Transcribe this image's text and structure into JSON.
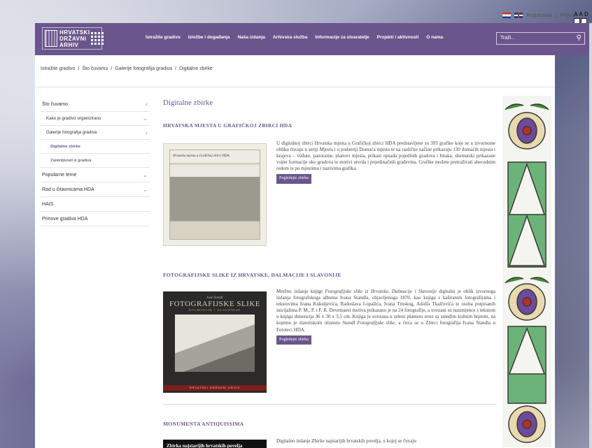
{
  "topbar": {
    "register": "Registracija",
    "separator": "|",
    "login": "Prijava"
  },
  "a11y": {
    "line1": "A A D"
  },
  "header": {
    "logo_lines": [
      "HRVATSKI",
      "DRŽAVNI",
      "ARHIV"
    ],
    "nav": [
      "Istražite gradivo",
      "Izložbe i događanja",
      "Naša izdanja",
      "Arhivska služba",
      "Informacije za stvaratelje",
      "Projekti i aktivnosti",
      "O nama"
    ],
    "search_placeholder": "Traži...",
    "search_icon": "search-icon",
    "brand_color": "#6a568d"
  },
  "breadcrumb": [
    "Istražite gradivo",
    "Što čuvamo",
    "Galerije fotografija gradiva",
    "Digitalne zbirke"
  ],
  "breadcrumb_sep": "/",
  "sidebar": {
    "items": [
      {
        "label": "Što čuvamo",
        "level": 1,
        "chevron": "‹"
      },
      {
        "label": "Kako je gradivo organizirano",
        "level": 2,
        "chevron": "⌄"
      },
      {
        "label": "Galerije fotografija gradiva",
        "level": 2,
        "chevron": "‹"
      },
      {
        "label": "Digitalne zbirke",
        "level": 3,
        "chevron": ""
      },
      {
        "label": "Zanimljivosti iz gradiva",
        "level": 3,
        "chevron": ""
      },
      {
        "label": "Popularne teme",
        "level": 1,
        "chevron": "⌄"
      },
      {
        "label": "Rad u čitaonicama HDA",
        "level": 1,
        "chevron": "⌄"
      },
      {
        "label": "HAIS",
        "level": 1,
        "chevron": ""
      },
      {
        "label": "Prinove gradiva HDA",
        "level": 1,
        "chevron": ""
      }
    ]
  },
  "main": {
    "title": "Digitalne zbirke",
    "sections": [
      {
        "title": "HRVATSKA MJESTA U GRAFIČKOJ ZBIRCI HDA",
        "thumb_caption": "Hrvatska mjesta u Grafičkoj zbirci HDA",
        "text": "U digitalnoj zbirci Hrvatska mjesta u Grafičkoj zbirci HDA predstavljene su 393 grafike koje se u izvornome obliku čuvaju u seriji Mjesta i u podseriji Domaća mjesta te na različite načine prikazuju 130 domaćih mjesta i krajeva – vedute, panorame, planovi mjesta, prikazi opsada pojedinih gradova i bitaka, shematski prikazane vojne formacije oko gradova te motivi utvrda i pojedinačnih građevina. Grafike možete pretraživati abecednim redom te po mjestima i nazivima grafika.",
        "button": "Pogledajte zbirku"
      },
      {
        "title": "FOTOGRAFIJSKE SLIKE IZ HRVATSKE, DALMACIJE I SLAVONIJE",
        "thumb_author": "Ivan Standl",
        "thumb_title": "FOTOGRAFIJSKE SLIKE",
        "thumb_sub": "DALMACIJE I SLAVONIJE",
        "thumb_strip": "HRVATSKI DRŽAVNI ARHIV",
        "text_parts": [
          "Mrežno izdanje knjige ",
          "Fotografijske slike iz Hrvatske, Dalmacije i Slavonije",
          " digitalni je oblik izvornoga izdanja fotografskoga albuma Ivana Standla, objavljenoga 1870. kao knjiga s kaširanim fotografijama i tekstovima Ivana Kukuljevića, Radoslava Lopašića, Ivana Trnskog, Adolfa Tkalčevića te osoba potpisanih inicijalima P. M., P. i F. R. Devetnaest motiva prikazano je na 24 fotografije, a uvezani su naizmjence s tekstom u knjigu dimenzija 36 x 30 x 3,5 cm. Knjiga je uvezana u zeleni platneni uvez sa smeđim kožnim hrptom, na kojemu je zlatotiskom otisnuto ",
          "Standl Fotografijske slike",
          ", a čuva se u Zbirci fotografija Ivana Standla u Fototeci HDA."
        ],
        "button": "Pogledajte zbirku"
      },
      {
        "title": "MONUMENTA ANTIQUISSIMA",
        "thumb_text": "Zbirka najstarijih hrvatskih povelja",
        "text": "Digitalno izdanje Zbirke najstarijih hrvatskih povelja, u kojoj se čuvaju"
      }
    ]
  }
}
